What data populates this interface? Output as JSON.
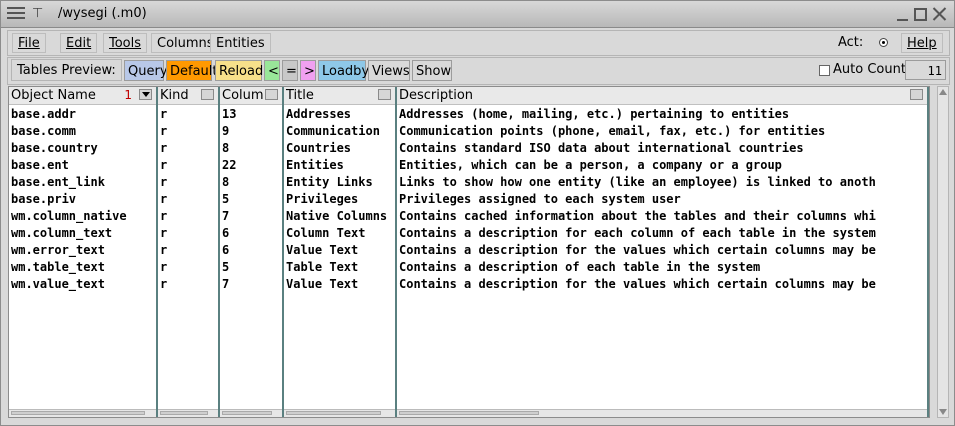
{
  "window": {
    "title": "/wysegi (.m0)"
  },
  "menu": {
    "file": "File",
    "edit": "Edit",
    "tools": "Tools",
    "columns": "Columns",
    "entities": "Entities",
    "act_label": "Act:",
    "help": "Help"
  },
  "toolbar": {
    "label": "Tables Preview:",
    "query": "Query",
    "default": "Default",
    "reload": "Reload",
    "prev": "<",
    "eq": "=",
    "next": ">",
    "loadby": "Loadby",
    "views": "Views",
    "show": "Show",
    "auto_count_label": "Auto Count:",
    "auto_count_value": "11",
    "colors": {
      "query": "#b8c8e8",
      "default": "#ff9900",
      "reload": "#f7e08a",
      "prev": "#99e699",
      "eq": "#c8c8c8",
      "next": "#f0a0f0",
      "loadby": "#8ec8e8"
    }
  },
  "table": {
    "sort_index": "1",
    "columns": [
      {
        "key": "name",
        "label": "Object Name"
      },
      {
        "key": "kind",
        "label": "Kind"
      },
      {
        "key": "colnum",
        "label": "Colum"
      },
      {
        "key": "title",
        "label": "Title"
      },
      {
        "key": "description",
        "label": "Description"
      }
    ],
    "rows": [
      {
        "name": "base.addr",
        "kind": "r",
        "colnum": "13",
        "title": "Addresses",
        "description": "Addresses (home, mailing, etc.) pertaining to entities"
      },
      {
        "name": "base.comm",
        "kind": "r",
        "colnum": "9",
        "title": "Communication",
        "description": "Communication points (phone, email, fax, etc.) for entities"
      },
      {
        "name": "base.country",
        "kind": "r",
        "colnum": "8",
        "title": "Countries",
        "description": "Contains standard ISO data about international countries"
      },
      {
        "name": "base.ent",
        "kind": "r",
        "colnum": "22",
        "title": "Entities",
        "description": "Entities, which can be a person, a company or a group"
      },
      {
        "name": "base.ent_link",
        "kind": "r",
        "colnum": "8",
        "title": "Entity Links",
        "description": "Links to show how one entity (like an employee) is linked to anoth"
      },
      {
        "name": "base.priv",
        "kind": "r",
        "colnum": "5",
        "title": "Privileges",
        "description": "Privileges assigned to each system user"
      },
      {
        "name": "wm.column_native",
        "kind": "r",
        "colnum": "7",
        "title": "Native Columns",
        "description": "Contains cached information about the tables and their columns whi"
      },
      {
        "name": "wm.column_text",
        "kind": "r",
        "colnum": "6",
        "title": "Column Text",
        "description": "Contains a description for each column of each table in the system"
      },
      {
        "name": "wm.error_text",
        "kind": "r",
        "colnum": "6",
        "title": "Value Text",
        "description": "Contains a description for the values which certain columns may be"
      },
      {
        "name": "wm.table_text",
        "kind": "r",
        "colnum": "5",
        "title": "Table Text",
        "description": "Contains a description of each table in the system"
      },
      {
        "name": "wm.value_text",
        "kind": "r",
        "colnum": "7",
        "title": "Value Text",
        "description": "Contains a description for the values which certain columns may be"
      }
    ]
  }
}
